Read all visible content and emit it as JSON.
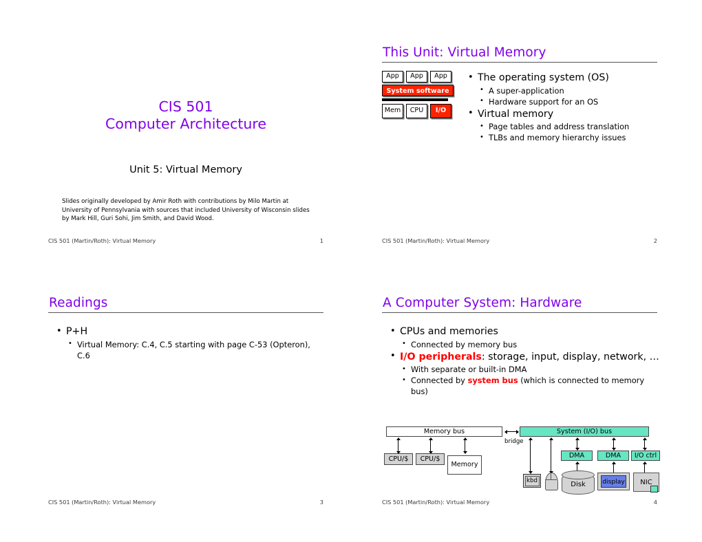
{
  "document": {
    "course": "CIS 501",
    "course_subtitle": "Computer Architecture",
    "unit": "Unit 5: Virtual Memory",
    "credit": "Slides originally developed by Amir Roth with contributions by Milo Martin at University of Pennsylvania with sources that included University of Wisconsin slides by Mark Hill, Guri Sohi, Jim Smith, and David Wood.",
    "footer_text": "CIS 501 (Martin/Roth): Virtual Memory",
    "accent_purple": "#8000e8",
    "accent_red": "#ff0000",
    "accent_teal": "#66e6c2",
    "accent_grey": "#d4d4d4",
    "accent_blue": "#667fe8"
  },
  "slides": [
    {
      "number": "1",
      "title": "CIS 501",
      "subtitle": "Computer Architecture",
      "unit": "Unit 5: Virtual Memory",
      "credit": "Slides originally developed by Amir Roth with contributions by Milo Martin at University of Pennsylvania with sources that included University of Wisconsin slides by Mark Hill, Guri Sohi, Jim Smith, and David Wood.",
      "footer": "CIS 501 (Martin/Roth): Virtual Memory"
    },
    {
      "number": "2",
      "title": "This Unit: Virtual Memory",
      "footer": "CIS 501 (Martin/Roth): Virtual Memory",
      "diagram": {
        "apps": [
          "App",
          "App",
          "App"
        ],
        "system_software": "System software",
        "hardware": [
          "Mem",
          "CPU",
          "I/O"
        ],
        "highlighted": [
          "System software",
          "I/O"
        ]
      },
      "bullets": [
        {
          "text": "The operating system (OS)",
          "sub": [
            "A super-application",
            "Hardware support for an OS"
          ]
        },
        {
          "text": "Virtual memory",
          "sub": [
            "Page tables and address translation",
            "TLBs and memory hierarchy issues"
          ]
        }
      ]
    },
    {
      "number": "3",
      "title": "Readings",
      "footer": "CIS 501 (Martin/Roth): Virtual Memory",
      "bullets": [
        {
          "text": "P+H",
          "sub": [
            "Virtual Memory: C.4, C.5 starting with page C-53 (Opteron), C.6"
          ]
        }
      ]
    },
    {
      "number": "4",
      "title": "A Computer System: Hardware",
      "footer": "CIS 501 (Martin/Roth): Virtual Memory",
      "bullets": [
        {
          "text": "CPUs and memories",
          "sub": [
            "Connected by memory bus"
          ]
        },
        {
          "text_parts": [
            {
              "t": "I/O peripherals",
              "red": true
            },
            {
              "t": ": storage, input, display, network, …",
              "red": false
            }
          ],
          "sub_parts": [
            [
              {
                "t": "With separate or built-in DMA",
                "red": false
              }
            ],
            [
              {
                "t": "Connected by ",
                "red": false
              },
              {
                "t": "system bus",
                "red": true
              },
              {
                "t": " (which is connected to memory bus)",
                "red": false
              }
            ]
          ]
        }
      ],
      "hw_diagram": {
        "memory_bus": "Memory bus",
        "system_bus": "System (I/O) bus",
        "bridge": "bridge",
        "cpu1": "CPU/$",
        "cpu2": "CPU/$",
        "memory": "Memory",
        "dma1": "DMA",
        "dma2": "DMA",
        "io_ctrl": "I/O ctrl",
        "kbd": "kbd",
        "disk": "Disk",
        "display": "display",
        "nic": "NIC"
      }
    }
  ]
}
